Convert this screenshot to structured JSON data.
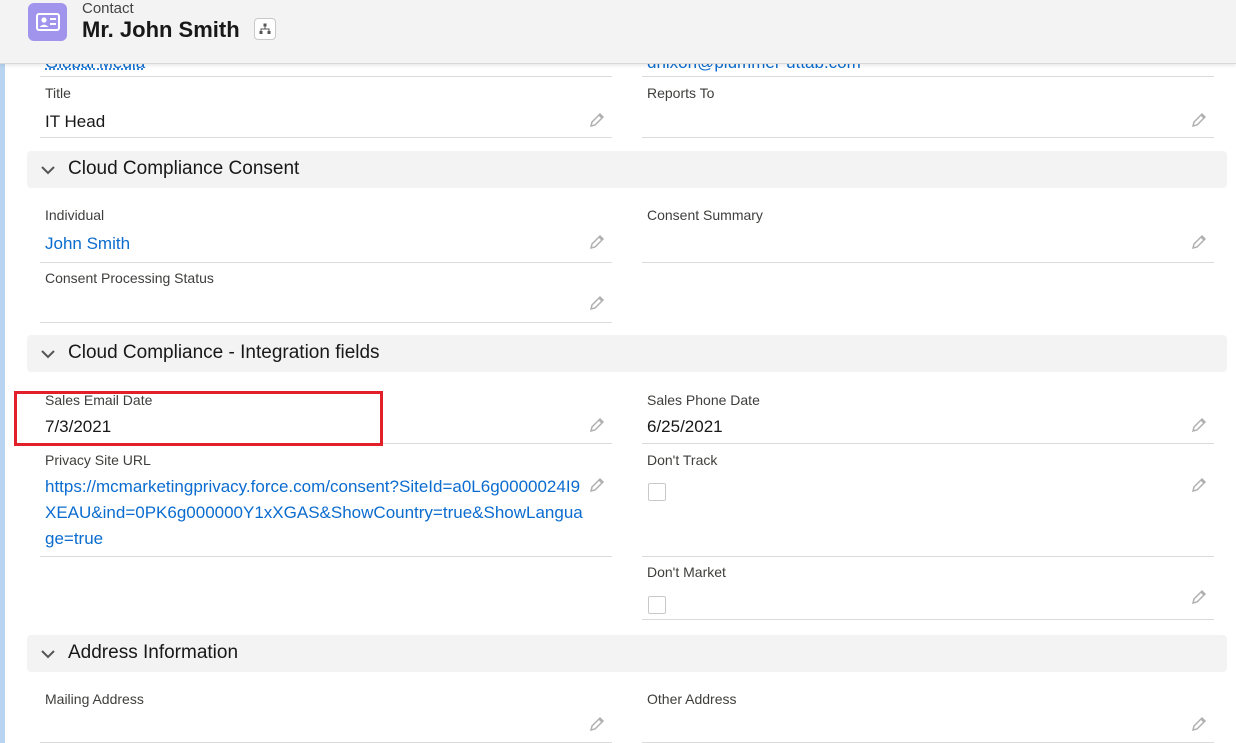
{
  "header": {
    "object_type": "Contact",
    "record_title": "Mr. John Smith"
  },
  "clipped_top": {
    "left_value": "Global Media",
    "right_value": "dnixon@plummer-uttab.com"
  },
  "fields_top": {
    "title_label": "Title",
    "title_value": "IT Head",
    "reports_to_label": "Reports To"
  },
  "sections": {
    "consent": "Cloud Compliance Consent",
    "integration": "Cloud Compliance - Integration fields",
    "address": "Address Information"
  },
  "consent": {
    "individual_label": "Individual",
    "individual_value": "John Smith",
    "consent_summary_label": "Consent Summary",
    "processing_status_label": "Consent Processing Status"
  },
  "integration": {
    "sales_email_date_label": "Sales Email Date",
    "sales_email_date_value": "7/3/2021",
    "sales_phone_date_label": "Sales Phone Date",
    "sales_phone_date_value": "6/25/2021",
    "privacy_url_label": "Privacy Site URL",
    "privacy_url_value": "https://mcmarketingprivacy.force.com/consent?SiteId=a0L6g0000024I9XEAU&ind=0PK6g000000Y1xXGAS&ShowCountry=true&ShowLanguage=true",
    "dont_track_label": "Don't Track",
    "dont_market_label": "Don't Market"
  },
  "address": {
    "mailing_label": "Mailing Address",
    "other_label": "Other Address"
  },
  "colors": {
    "link": "#0b6ccf",
    "object_icon_bg": "#a094ed",
    "highlight": "#e2202a"
  }
}
